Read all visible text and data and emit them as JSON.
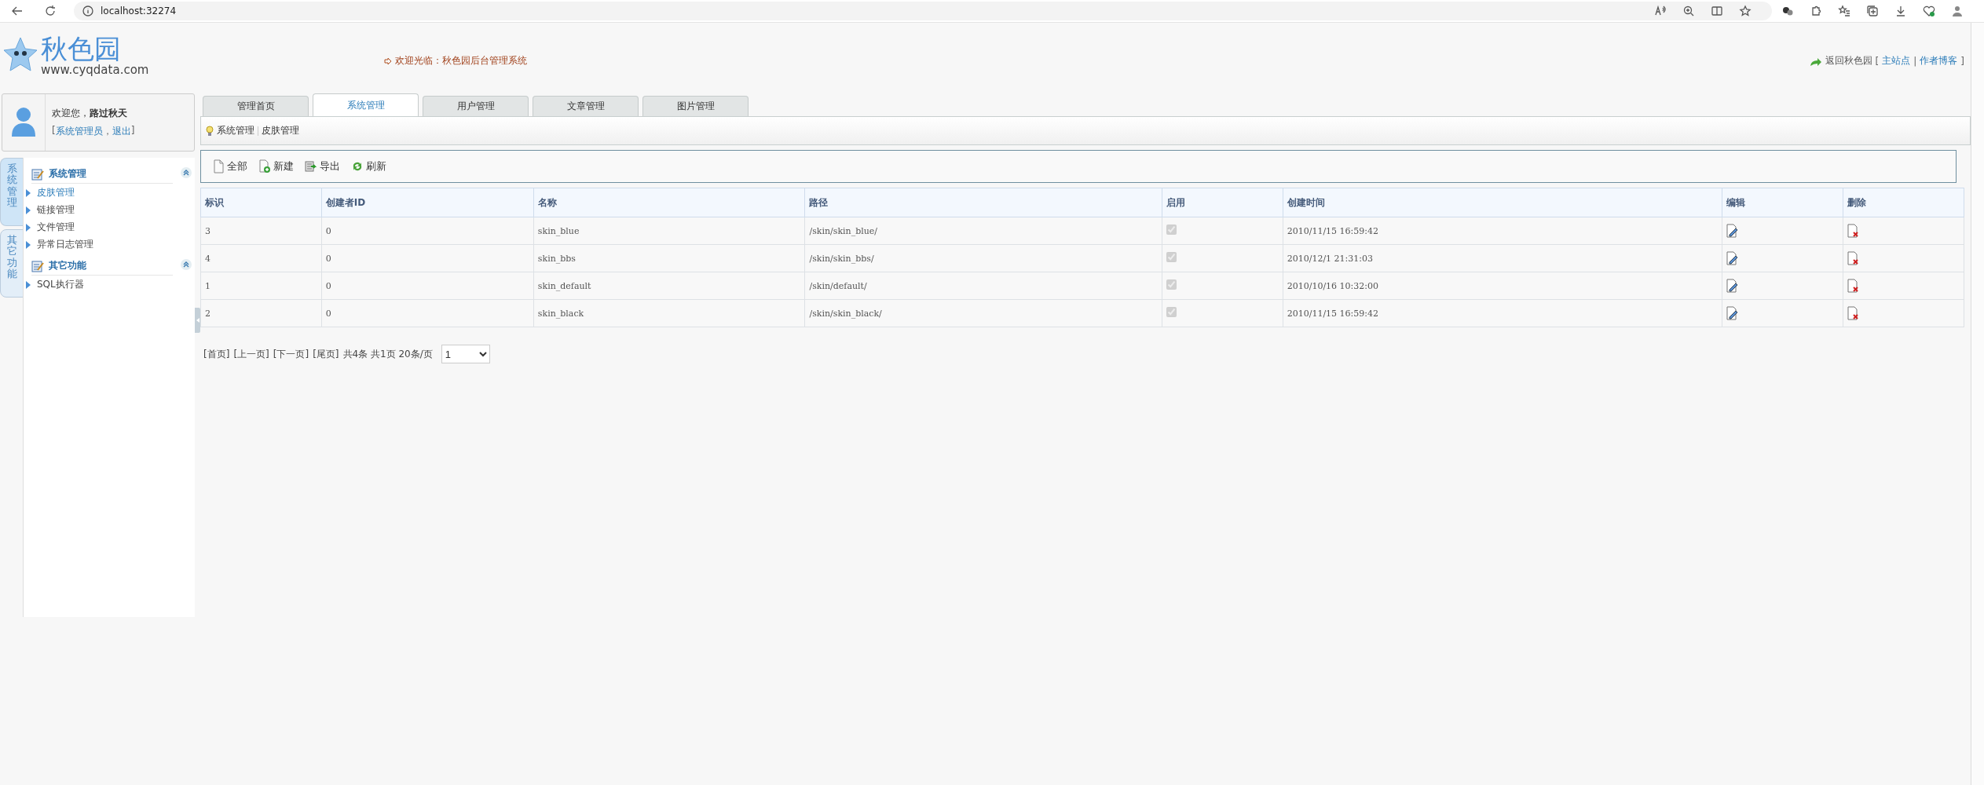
{
  "browser": {
    "address": "localhost:32274"
  },
  "header": {
    "logo_title": "秋色园",
    "logo_url": "www.cyqdata.com",
    "welcome": "欢迎光临：秋色园后台管理系统",
    "back_link": "返回秋色园",
    "links": [
      {
        "text": "[",
        "kind": "plain"
      },
      {
        "text": "主站点",
        "kind": "link"
      },
      {
        "text": "|",
        "kind": "plain"
      },
      {
        "text": "作者博客",
        "kind": "link"
      },
      {
        "text": "]",
        "kind": "plain"
      }
    ]
  },
  "user": {
    "greeting": "欢迎您，**路过秋天**",
    "links": [
      {
        "text": "[",
        "kind": "plain"
      },
      {
        "text": "系统管理员",
        "kind": "link"
      },
      {
        "text": "，",
        "kind": "plain"
      },
      {
        "text": "退出",
        "kind": "link"
      },
      {
        "text": "]",
        "kind": "plain"
      }
    ]
  },
  "sidebar": {
    "side_tabs": [
      {
        "label": "系统管理",
        "selected": true
      },
      {
        "label": "其它功能",
        "selected": false
      }
    ],
    "groups": [
      {
        "title": "系统管理",
        "expanded": true,
        "items": [
          {
            "label": "皮肤管理",
            "selected": true
          },
          {
            "label": "链接管理",
            "selected": false
          },
          {
            "label": "文件管理",
            "selected": false
          },
          {
            "label": "异常日志管理",
            "selected": false
          }
        ]
      },
      {
        "title": "其它功能",
        "expanded": true,
        "items": [
          {
            "label": "SQL执行器",
            "selected": false
          }
        ]
      }
    ]
  },
  "tabs": [
    {
      "label": "管理首页",
      "selected": false
    },
    {
      "label": "系统管理",
      "selected": true
    },
    {
      "label": "用户管理",
      "selected": false
    },
    {
      "label": "文章管理",
      "selected": false
    },
    {
      "label": "图片管理",
      "selected": false
    }
  ],
  "breadcrumb": [
    "系统管理",
    "皮肤管理"
  ],
  "toolbar": [
    {
      "label": "全部",
      "kind": "all"
    },
    {
      "label": "新建",
      "kind": "new"
    },
    {
      "label": "导出",
      "kind": "export"
    },
    {
      "label": "刷新",
      "kind": "refresh"
    }
  ],
  "table": {
    "columns": [
      "标识",
      "创建者ID",
      "名称",
      "路径",
      "启用",
      "创建时间",
      "编辑",
      "删除"
    ],
    "rows": [
      {
        "id": "3",
        "creator_id": "0",
        "name": "skin_blue",
        "path": "/skin/skin_blue/",
        "enabled": true,
        "created": "2010/11/15 16:59:42"
      },
      {
        "id": "4",
        "creator_id": "0",
        "name": "skin_bbs",
        "path": "/skin/skin_bbs/",
        "enabled": true,
        "created": "2010/12/1 21:31:03"
      },
      {
        "id": "1",
        "creator_id": "0",
        "name": "skin_default",
        "path": "/skin/default/",
        "enabled": true,
        "created": "2010/10/16 10:32:00"
      },
      {
        "id": "2",
        "creator_id": "0",
        "name": "skin_black",
        "path": "/skin/skin_black/",
        "enabled": true,
        "created": "2010/11/15 16:59:42"
      }
    ]
  },
  "pagination": {
    "links": [
      "[首页]",
      "[上一页]",
      "[下一页]",
      "[尾页]"
    ],
    "summary": "共4条 共1页 20条/页",
    "page_select": "1"
  }
}
